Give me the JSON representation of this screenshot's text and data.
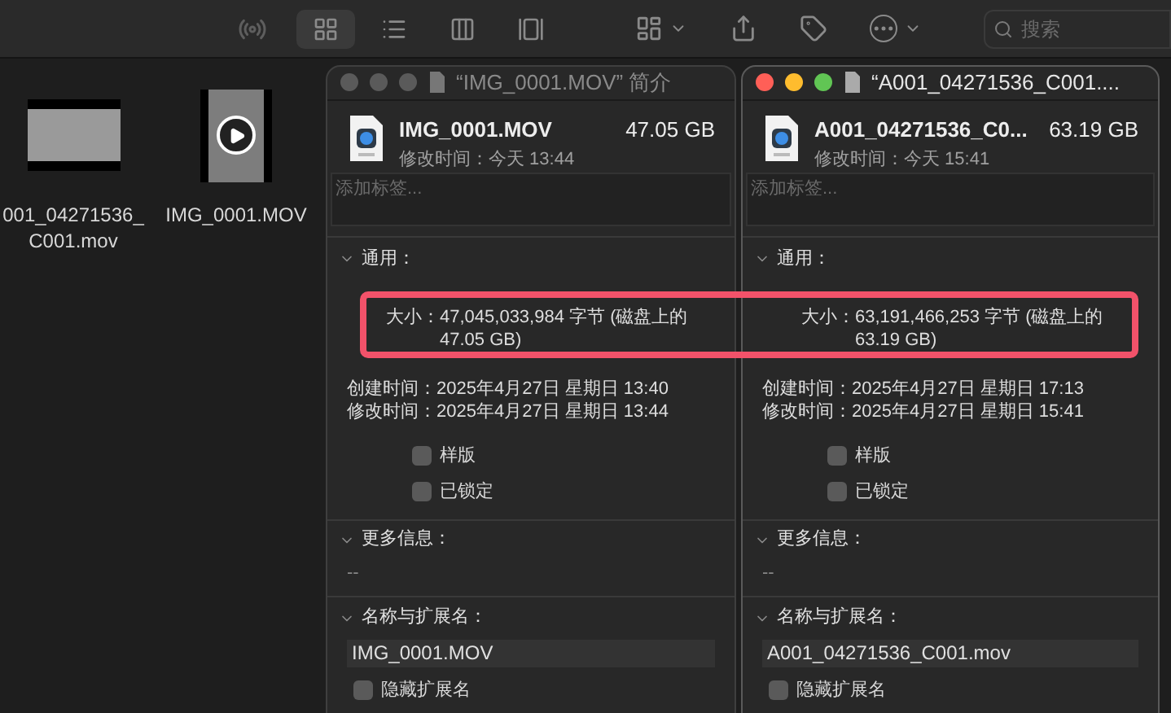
{
  "toolbar": {
    "view_buttons": [
      {
        "selected": true
      },
      {
        "selected": false
      },
      {
        "selected": false
      },
      {
        "selected": false
      }
    ],
    "search": {
      "placeholder": "搜索"
    }
  },
  "desktop_files": [
    {
      "label": [
        "001_04271536_",
        "C001.mov"
      ],
      "kind": "landscape"
    },
    {
      "label": [
        "IMG_0001.MOV"
      ],
      "kind": "portrait"
    }
  ],
  "windows": [
    {
      "active": false,
      "title": "“IMG_0001.MOV” 简介",
      "name": "IMG_0001.MOV",
      "size": "47.05 GB",
      "modified": "修改时间：今天 13:44",
      "tags": {
        "placeholder": "添加标签..."
      },
      "general": {
        "header": "通用：",
        "size_label": "大小：",
        "size_value": "47,045,033,984 字节 (磁盘上的 47.05 GB)",
        "rows": [
          {
            "label": "创建时间：",
            "value": "2025年4月27日 星期日 13:40"
          },
          {
            "label": "修改时间：",
            "value": "2025年4月27日 星期日 13:44"
          }
        ],
        "checkboxes": [
          {
            "label": "样版",
            "checked": false
          },
          {
            "label": "已锁定",
            "checked": false
          }
        ]
      },
      "more_info": {
        "header": "更多信息：",
        "value": "--"
      },
      "name_ext": {
        "header": "名称与扩展名：",
        "value": "IMG_0001.MOV",
        "hide_ext": {
          "label": "隐藏扩展名",
          "checked": false
        }
      }
    },
    {
      "active": true,
      "title": "“A001_04271536_C001....",
      "name": "A001_04271536_C0...",
      "size": "63.19 GB",
      "modified": "修改时间：今天 15:41",
      "tags": {
        "placeholder": "添加标签..."
      },
      "general": {
        "header": "通用：",
        "size_label": "大小：",
        "size_value": "63,191,466,253 字节 (磁盘上的 63.19 GB)",
        "rows": [
          {
            "label": "创建时间：",
            "value": "2025年4月27日 星期日 17:13"
          },
          {
            "label": "修改时间：",
            "value": "2025年4月27日 星期日 15:41"
          }
        ],
        "checkboxes": [
          {
            "label": "样版",
            "checked": false
          },
          {
            "label": "已锁定",
            "checked": false
          }
        ]
      },
      "more_info": {
        "header": "更多信息：",
        "value": "--"
      },
      "name_ext": {
        "header": "名称与扩展名：",
        "value": "A001_04271536_C001.mov",
        "hide_ext": {
          "label": "隐藏扩展名",
          "checked": false
        }
      }
    }
  ]
}
